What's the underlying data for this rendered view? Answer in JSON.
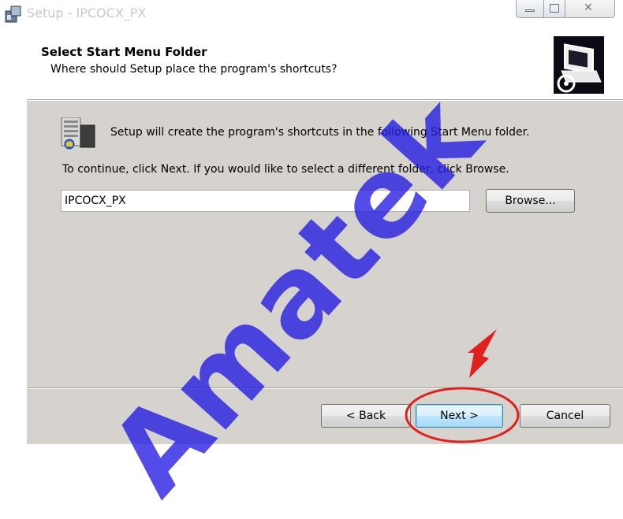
{
  "window": {
    "title": "Setup - IPCOCX_PX"
  },
  "header": {
    "title": "Select Start Menu Folder",
    "subtitle": "Where should Setup place the program's shortcuts?"
  },
  "body": {
    "info_text": "Setup will create the program's shortcuts in the following Start Menu folder.",
    "continue_text": "To continue, click Next. If you would like to select a different folder, click Browse.",
    "folder_value": "IPCOCX_PX",
    "browse_label": "Browse..."
  },
  "footer": {
    "back_label": "< Back",
    "next_label": "Next >",
    "cancel_label": "Cancel"
  },
  "annotations": {
    "watermark": "Amatek",
    "highlight_color": "#e0201c",
    "watermark_color": "#2319e1"
  },
  "icons": [
    "setup-app-icon",
    "minimize-icon",
    "maximize-icon",
    "close-icon",
    "computer-install-icon",
    "start-menu-folder-icon",
    "red-arrow-icon"
  ]
}
